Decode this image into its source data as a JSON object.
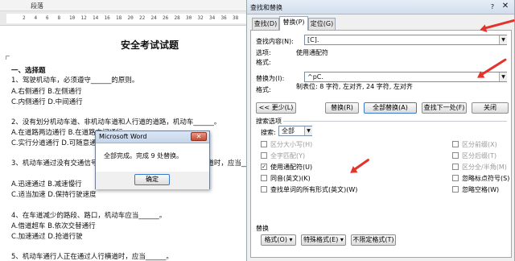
{
  "ribbon": {
    "group_label": "段落"
  },
  "ruler": {
    "ticks": [
      "2",
      "4",
      "6",
      "8",
      "10",
      "12",
      "14",
      "16",
      "18",
      "20",
      "22",
      "24",
      "26",
      "28",
      "30",
      "32",
      "34",
      "36",
      "38"
    ]
  },
  "document": {
    "title": "安全考试试题",
    "lines": [
      "一、选择题",
      "1、驾驶机动车，必须遵守______的原则。",
      "A.右侧通行  B.左侧通行",
      "C.内侧通行  D.中间通行",
      "2、没有划分机动车道、非机动车道和人行道的道路，机动车______。",
      "A.在道路两边通行  B.在道路中间通行",
      "C.实行分道通行  D.可随意通行",
      "3、机动车通过没有交通信号灯控制也没有交通警察指挥的人行横道时，应当______。",
      "A.迅速通过  B.减速慢行",
      "C.适当加速  D.保持行驶速度",
      "4、在车道减少的路段、路口，机动车应当______。",
      "A.借道超车  B.依次交替通行",
      "C.加速通过  D.抢道行驶",
      "5、机动车通行人正在通过人行横道时，应当______。"
    ]
  },
  "msgbox": {
    "title": "Microsoft Word",
    "message": "全部完成。完成 9 处替换。",
    "ok_label": "确定",
    "close_glyph": "✕"
  },
  "dialog": {
    "title": "查找和替换",
    "help_glyph": "?",
    "close_glyph": "✕",
    "tabs": [
      {
        "label": "查找(D)"
      },
      {
        "label": "替换(P)"
      },
      {
        "label": "定位(G)"
      }
    ],
    "find": {
      "label": "查找内容(N):",
      "value": "[C].",
      "options_label": "选项:",
      "options_value": "使用通配符",
      "format_label": "格式:"
    },
    "replace": {
      "label": "替换为(I):",
      "value": "^pC.",
      "format_label": "格式:",
      "format_value": "制表位: 8 字符, 左对齐, 24 字符, 左对齐"
    },
    "buttons": {
      "less": "<< 更少(L)",
      "replace": "替换(R)",
      "replace_all": "全部替换(A)",
      "find_next": "查找下一处(F)",
      "close": "关闭"
    },
    "search_options": {
      "header": "搜索选项",
      "search_label": "搜索:",
      "search_value": "全部",
      "left": [
        {
          "label": "区分大小写(H)",
          "checked": false,
          "disabled": true
        },
        {
          "label": "全字匹配(Y)",
          "checked": false,
          "disabled": true
        },
        {
          "label": "使用通配符(U)",
          "checked": true,
          "disabled": false
        },
        {
          "label": "同音(英文)(K)",
          "checked": false,
          "disabled": false
        },
        {
          "label": "查找单词的所有形式(英文)(W)",
          "checked": false,
          "disabled": false
        }
      ],
      "right": [
        {
          "label": "区分前缀(X)",
          "checked": false,
          "disabled": true
        },
        {
          "label": "区分后缀(T)",
          "checked": false,
          "disabled": true
        },
        {
          "label": "区分全/半角(M)",
          "checked": false,
          "disabled": true
        },
        {
          "label": "忽略标点符号(S)",
          "checked": false,
          "disabled": false
        },
        {
          "label": "忽略空格(W)",
          "checked": false,
          "disabled": false
        }
      ]
    },
    "replace_section": {
      "header": "替换",
      "format": "格式(O) ▾",
      "special": "特殊格式(E) ▾",
      "no_format": "不限定格式(T)"
    }
  },
  "colors": {
    "accent_arrow": "#e5322a",
    "dialog_bg": "#f0f0f0",
    "title_bar": "#d2deee"
  }
}
